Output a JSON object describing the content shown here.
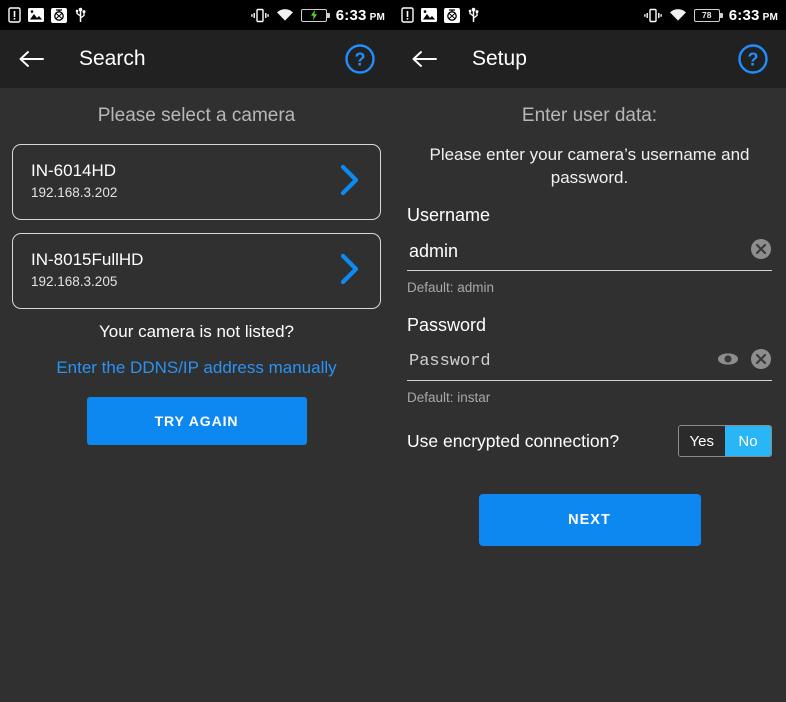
{
  "status_bar": {
    "left": {
      "icons": [
        "sd-card-alert-icon",
        "image-icon",
        "app-icon",
        "usb-icon"
      ],
      "right_icons": [
        "vibrate-icon",
        "wifi-icon",
        "battery-charging-icon"
      ],
      "battery_label": "",
      "time": "6:33",
      "ampm": "PM"
    },
    "right": {
      "icons": [
        "sd-card-alert-icon",
        "image-icon",
        "app-icon",
        "usb-icon"
      ],
      "right_icons": [
        "vibrate-icon",
        "wifi-icon",
        "battery-icon"
      ],
      "battery_label": "78",
      "time": "6:33",
      "ampm": "PM"
    }
  },
  "left_panel": {
    "appbar": {
      "title": "Search",
      "back_icon": "back-arrow-icon",
      "help_icon": "help-circle-icon"
    },
    "section_title": "Please select a camera",
    "cameras": [
      {
        "name": "IN-6014HD",
        "ip": "192.168.3.202"
      },
      {
        "name": "IN-8015FullHD",
        "ip": "192.168.3.205"
      }
    ],
    "not_listed_text": "Your camera is not listed?",
    "manual_link": "Enter the DDNS/IP address manually",
    "try_again_label": "TRY AGAIN"
  },
  "right_panel": {
    "appbar": {
      "title": "Setup",
      "back_icon": "back-arrow-icon",
      "help_icon": "help-circle-icon"
    },
    "section_title": "Enter user data:",
    "intro": "Please enter your camera’s username and password.",
    "username": {
      "label": "Username",
      "value": "admin",
      "placeholder": "Username",
      "hint": "Default: admin",
      "clear_icon": "clear-circle-icon"
    },
    "password": {
      "label": "Password",
      "value": "",
      "placeholder": "Password",
      "hint": "Default: instar",
      "reveal_icon": "eye-icon",
      "clear_icon": "clear-circle-icon"
    },
    "encryption": {
      "label": "Use encrypted connection?",
      "options": [
        "Yes",
        "No"
      ],
      "selected": "No"
    },
    "next_label": "NEXT"
  },
  "colors": {
    "accent_blue": "#0d88f0",
    "toggle_blue": "#29b6f6",
    "link_blue": "#2a92f5",
    "background": "#303030",
    "appbar": "#212121"
  }
}
